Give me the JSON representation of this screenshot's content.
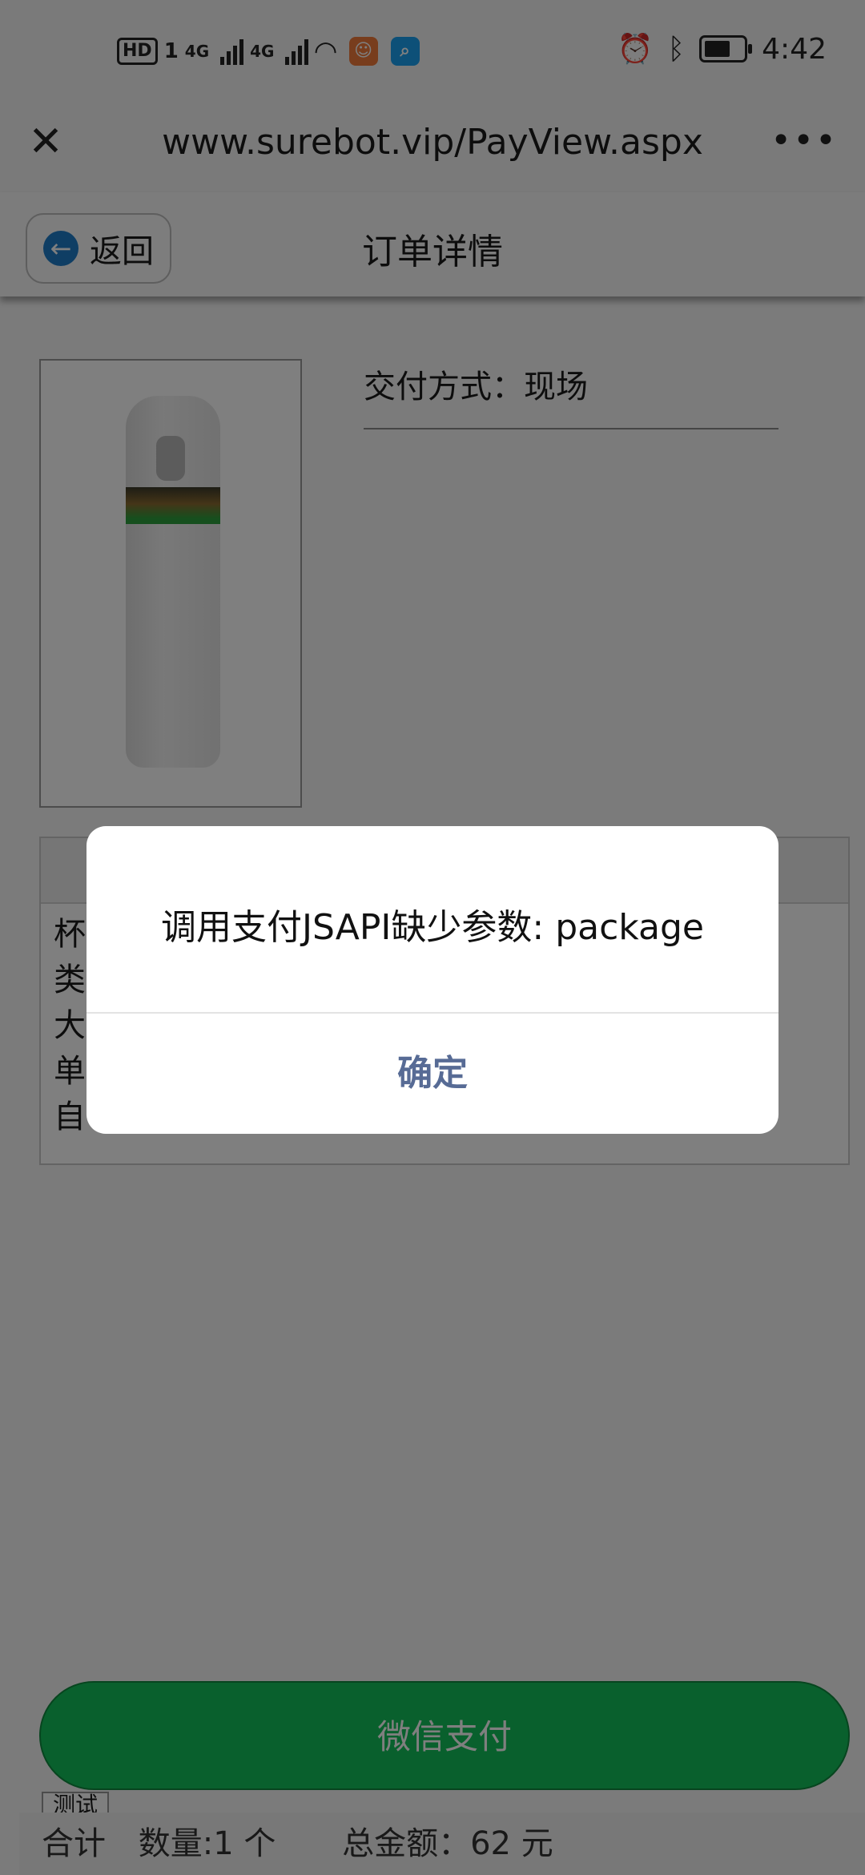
{
  "status_bar": {
    "hd": "HD",
    "sim": "1",
    "net1": "4G",
    "net2": "4G",
    "time": "4:42"
  },
  "browser": {
    "url": "www.surebot.vip/PayView.aspx"
  },
  "header": {
    "back_label": "返回",
    "title": "订单详情"
  },
  "order": {
    "delivery": "交付方式：现场",
    "detail_lines": [
      "杯",
      "类",
      "大",
      "单",
      "自"
    ]
  },
  "pay_button": "微信支付",
  "test_tab": "测试",
  "footer": {
    "total_label": "合计",
    "quantity": "数量:1 个",
    "amount": "总金额：62 元"
  },
  "dialog": {
    "message": "调用支付JSAPI缺少参数: package",
    "ok": "确定"
  },
  "colors": {
    "pay_green": "#13c15a",
    "dialog_button": "#576b95",
    "back_icon": "#1e7cc9"
  }
}
